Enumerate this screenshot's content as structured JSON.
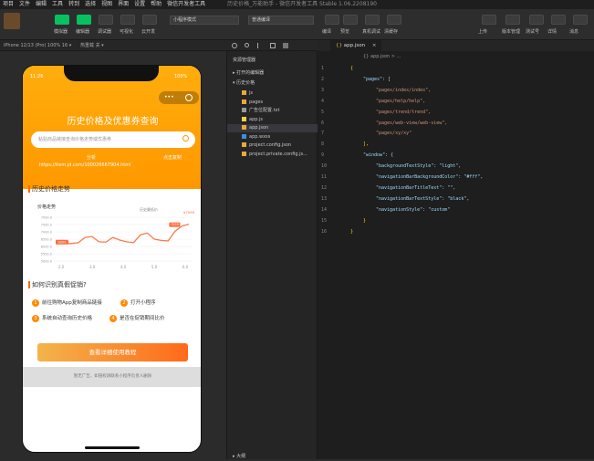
{
  "menu": [
    "项目",
    "文件",
    "编辑",
    "工具",
    "转到",
    "选择",
    "视图",
    "界面",
    "设置",
    "帮助",
    "微信开发者工具"
  ],
  "window_title": "历史价格_万能助手 - 微信开发者工具 Stable 1.06.2208190",
  "toolbar": {
    "buttons": [
      {
        "label": "模拟器",
        "x": 60
      },
      {
        "label": "编辑器",
        "x": 84
      },
      {
        "label": "调试器",
        "x": 108
      },
      {
        "label": "可视化",
        "x": 132
      },
      {
        "label": "云开发",
        "x": 156
      }
    ],
    "mode_select": "小程序模式",
    "compile_select": "普通编译",
    "mid_buttons": [
      "编译",
      "预览",
      "真机调试",
      "清缓存"
    ],
    "right_buttons": [
      "上传",
      "版本管理",
      "测试号",
      "详情",
      "消息"
    ]
  },
  "subbar": {
    "device": "iPhone 12/13 (Pro) 100% 16 ▾",
    "network": "热重载 关 ▾"
  },
  "phone": {
    "status_time": "11:26",
    "battery": "100%",
    "title": "历史价格及优惠券查询",
    "search_placeholder": "粘贴商品链接查询价格走势或优惠券",
    "share_left": "分析",
    "share_right": "点击复制",
    "share_link": "https://item.jd.com/100026667904.html",
    "chart_section": "历史价格走势",
    "chart_section_label": "价格走势",
    "chart_legend": "历史最低价",
    "howto_section": "如何识别真假促销?",
    "steps": [
      "前往购物App复制商品链接",
      "打开小程序",
      "系统自动查询历史价格",
      "是否在促销期间比价"
    ],
    "button": "查看详细使用教程",
    "footer": "暂无广告，如侵权请联系小程序负责人删除"
  },
  "chart_data": {
    "type": "line",
    "x": [
      "2.0",
      "3.0",
      "4.0",
      "5.0",
      "6.0"
    ],
    "yticks": [
      "7000.0",
      "7500.0",
      "7000.0",
      "6500.0",
      "6000.0",
      "5500.0",
      "5000.0"
    ],
    "values": [
      6000,
      6000,
      6000,
      6050,
      6350,
      6400,
      6100,
      6080,
      6350,
      6200,
      6100,
      6050,
      6500,
      6600,
      6250,
      6180,
      6150,
      6700,
      7000,
      7100
    ],
    "low_label": "6000",
    "high_label": "7099",
    "max_label": "¥7099",
    "ylim": [
      5000,
      7500
    ]
  },
  "explorer": {
    "header": "资源管理器",
    "open_editors": "打开的编辑器",
    "root": "历史价格",
    "items": [
      {
        "name": "js",
        "indent": 2,
        "color": "#e8a93b"
      },
      {
        "name": "pages",
        "indent": 2,
        "color": "#e8a93b"
      },
      {
        "name": "广告位配置.txt",
        "indent": 2,
        "color": "#999999"
      },
      {
        "name": "app.js",
        "indent": 2,
        "color": "#e8d44d"
      },
      {
        "name": "app.json",
        "indent": 2,
        "color": "#e8a93b",
        "selected": true
      },
      {
        "name": "app.wxss",
        "indent": 2,
        "color": "#3b8ee8"
      },
      {
        "name": "project.config.json",
        "indent": 2,
        "color": "#e8a93b"
      },
      {
        "name": "project.private.config.js...",
        "indent": 2,
        "color": "#e8a93b"
      }
    ],
    "outline": "大纲"
  },
  "editor": {
    "tab": "app.json",
    "breadcrumb": "{} app.json > ...",
    "lines": [
      {
        "n": "1",
        "t": "{",
        "c": "b",
        "ind": 0
      },
      {
        "n": "2",
        "t": "\"pages\": [",
        "c": "k",
        "ind": 1
      },
      {
        "n": "3",
        "t": "\"pages/index/index\",",
        "c": "s",
        "ind": 2
      },
      {
        "n": "4",
        "t": "\"pages/help/help\",",
        "c": "s",
        "ind": 2
      },
      {
        "n": "5",
        "t": "\"pages/trend/trend\",",
        "c": "s",
        "ind": 2
      },
      {
        "n": "6",
        "t": "\"pages/web-view/web-view\",",
        "c": "s",
        "ind": 2
      },
      {
        "n": "7",
        "t": "\"pages/xy/xy\"",
        "c": "s",
        "ind": 2
      },
      {
        "n": "8",
        "t": "],",
        "c": "b",
        "ind": 1
      },
      {
        "n": "9",
        "t": "\"window\": {",
        "c": "k",
        "ind": 1
      },
      {
        "n": "10",
        "t": "\"backgroundTextStyle\": \"light\",",
        "c": "kv",
        "ind": 2
      },
      {
        "n": "11",
        "t": "\"navigationBarBackgroundColor\": \"#fff\",",
        "c": "kv",
        "ind": 2
      },
      {
        "n": "12",
        "t": "\"navigationBarTitleText\": \"\",",
        "c": "kv",
        "ind": 2
      },
      {
        "n": "13",
        "t": "\"navigationBarTextStyle\": \"black\",",
        "c": "kv",
        "ind": 2
      },
      {
        "n": "14",
        "t": "\"navigationStyle\": \"custom\"",
        "c": "kv",
        "ind": 2
      },
      {
        "n": "15",
        "t": "}",
        "c": "b",
        "ind": 1
      },
      {
        "n": "16",
        "t": "}",
        "c": "b",
        "ind": 0
      }
    ]
  }
}
